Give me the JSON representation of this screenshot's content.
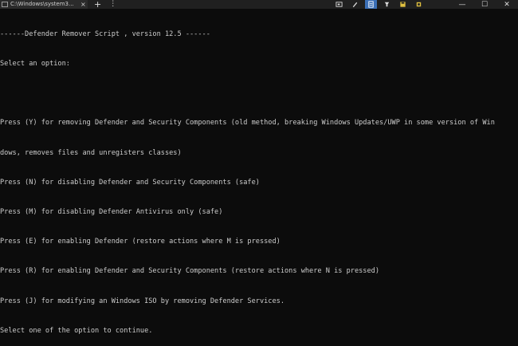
{
  "window": {
    "tab_title": "C:\\Windows\\system3...",
    "tab_close": "×",
    "new_tab": "+",
    "tab_menu": "⋮"
  },
  "controls": {
    "minimize": "—",
    "maximize": "☐",
    "close": "✕"
  },
  "console": {
    "lines": [
      "------Defender Remover Script , version 12.5 ------",
      "Select an option:",
      "",
      "Press (Y) for removing Defender and Security Components (old method, breaking Windows Updates/UWP in some version of Win",
      "dows, removes files and unregisters classes)",
      "Press (N) for disabling Defender and Security Components (safe)",
      "Press (M) for disabling Defender Antivirus only (safe)",
      "Press (E) for enabling Defender (restore actions where M is pressed)",
      "Press (R) for enabling Defender and Security Components (restore actions where N is pressed)",
      "Press (J) for modifying an Windows ISO by removing Defender Services.",
      "Select one of the option to continue."
    ]
  },
  "colors": {
    "background": "#0c0c0c",
    "text": "#cccccc",
    "titlebar": "#202020",
    "active_tray": "#3b6fb6"
  }
}
